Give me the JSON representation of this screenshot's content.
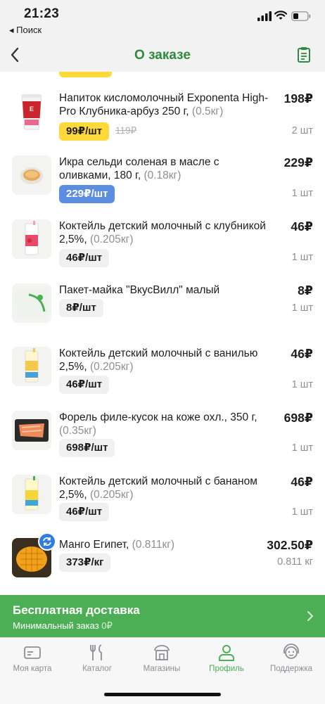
{
  "status_bar": {
    "time": "21:23",
    "back_label": "◂ Поиск"
  },
  "header": {
    "title": "О заказе"
  },
  "items": [
    {
      "name": "Напиток кисломолочный Exponenta High-Pro Клубника-арбуз 250 г,",
      "weight": "(0.5кг)",
      "price": "198₽",
      "unit_price": "99₽/шт",
      "old_price": "119₽",
      "qty": "2 шт",
      "tag": "yellow"
    },
    {
      "name": "Икра сельди соленая в масле с оливками, 180 г,",
      "weight": "(0.18кг)",
      "price": "229₽",
      "unit_price": "229₽/шт",
      "qty": "1 шт",
      "tag": "blue"
    },
    {
      "name": "Коктейль детский молочный с клубникой 2,5%,",
      "weight": "(0.205кг)",
      "price": "46₽",
      "unit_price": "46₽/шт",
      "qty": "1 шт",
      "tag": "gray"
    },
    {
      "name": "Пакет-майка \"ВкусВилл\" малый",
      "weight": "",
      "price": "8₽",
      "unit_price": "8₽/шт",
      "qty": "1 шт",
      "tag": "gray"
    },
    {
      "name": "Коктейль детский молочный с ванилью 2,5%,",
      "weight": "(0.205кг)",
      "price": "46₽",
      "unit_price": "46₽/шт",
      "qty": "1 шт",
      "tag": "gray"
    },
    {
      "name": "Форель филе-кусок на коже охл., 350 г,",
      "weight": "(0.35кг)",
      "price": "698₽",
      "unit_price": "698₽/шт",
      "qty": "1 шт",
      "tag": "gray"
    },
    {
      "name": "Коктейль детский молочный с бананом 2,5%,",
      "weight": "(0.205кг)",
      "price": "46₽",
      "unit_price": "46₽/шт",
      "qty": "1 шт",
      "tag": "gray"
    },
    {
      "name": "Манго Египет,",
      "weight": "(0.811кг)",
      "price": "302.50₽",
      "unit_price": "373₽/кг",
      "qty": "0.811 кг",
      "tag": "gray"
    }
  ],
  "delivery": {
    "title": "Бесплатная доставка",
    "subtitle": "Минимальный заказ",
    "min_value": "0₽"
  },
  "tabbar": [
    {
      "label": "Моя карта",
      "icon": "card-icon"
    },
    {
      "label": "Каталог",
      "icon": "cutlery-icon"
    },
    {
      "label": "Магазины",
      "icon": "store-icon"
    },
    {
      "label": "Профиль",
      "icon": "profile-icon",
      "active": true
    },
    {
      "label": "Поддержка",
      "icon": "support-icon"
    }
  ],
  "colors": {
    "brand_green": "#4cae55",
    "title_green": "#2e8b3e",
    "yellow_tag": "#ffd83a",
    "blue_tag": "#5b8de0"
  }
}
